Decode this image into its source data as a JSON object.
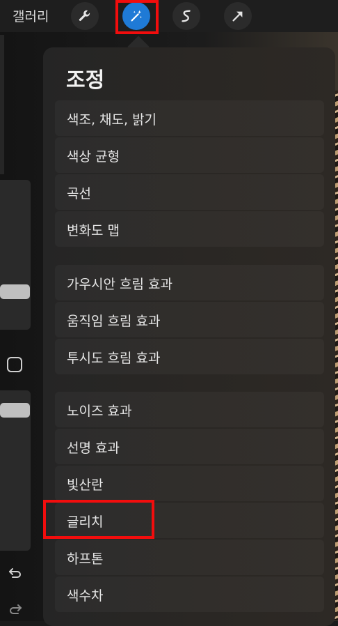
{
  "toolbar": {
    "gallery_label": "갤러리",
    "tools": [
      {
        "name": "wrench-icon",
        "active": false
      },
      {
        "name": "magic-wand-icon",
        "active": true
      },
      {
        "name": "selection-icon",
        "active": false
      },
      {
        "name": "arrow-icon",
        "active": false
      }
    ],
    "active_color": "#1f7ad6"
  },
  "menu": {
    "title": "조정",
    "groups": [
      [
        "색조, 채도, 밝기",
        "색상 균형",
        "곡선",
        "변화도 맵"
      ],
      [
        "가우시안 흐림 효과",
        "움직임 흐림 효과",
        "투시도 흐림 효과"
      ],
      [
        "노이즈 효과",
        "선명 효과",
        "빛산란",
        "글리치",
        "하프톤",
        "색수차"
      ]
    ]
  },
  "highlight_color": "#f20d0d"
}
